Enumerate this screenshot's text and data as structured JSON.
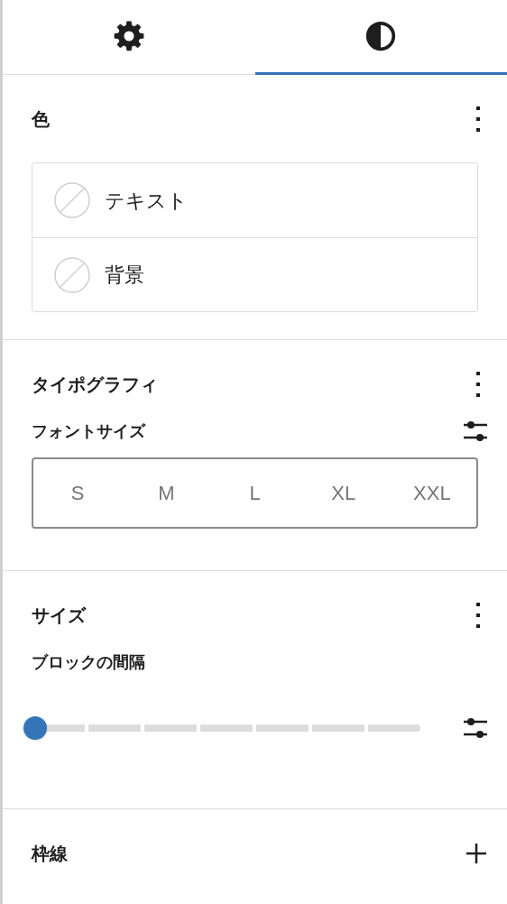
{
  "tabs": [
    {
      "kind": "gear",
      "selected": false
    },
    {
      "kind": "contrast",
      "selected": true
    }
  ],
  "sections": [
    {
      "kind": "colors",
      "title": "色",
      "button": {
        "kind": "menu"
      },
      "items": [
        {
          "label": "テキスト"
        },
        {
          "label": "背景"
        }
      ]
    },
    {
      "kind": "typography",
      "title": "タイポグラフィ",
      "button": {
        "kind": "menu"
      },
      "font_size": {
        "label": "フォントサイズ",
        "options": [
          {
            "label": "S",
            "selected": false
          },
          {
            "label": "M",
            "selected": false
          },
          {
            "label": "L",
            "selected": false
          },
          {
            "label": "XL",
            "selected": false
          },
          {
            "label": "XXL",
            "selected": false
          }
        ]
      }
    },
    {
      "kind": "size",
      "title": "サイズ",
      "button": {
        "kind": "menu"
      },
      "block_spacing": {
        "label": "ブロックの間隔",
        "level": 0
      }
    },
    {
      "kind": "border",
      "title": "枠線",
      "button": {
        "kind": "add"
      }
    }
  ]
}
